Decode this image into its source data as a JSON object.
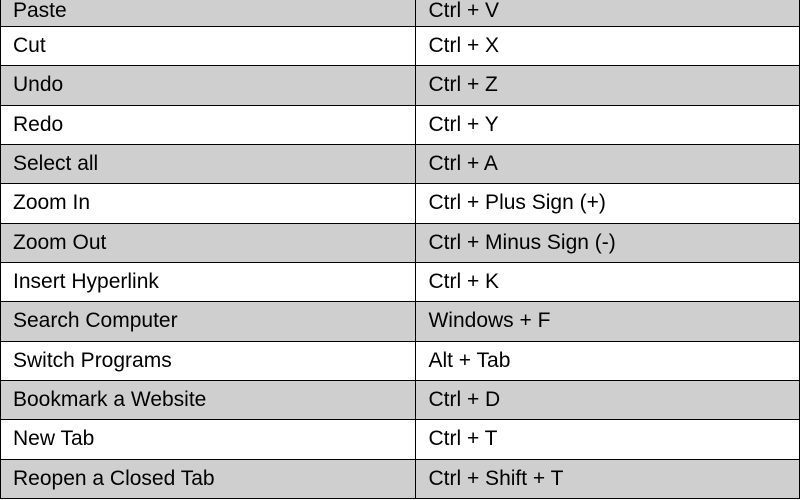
{
  "shortcuts": {
    "rows": [
      {
        "action": "Paste",
        "key": "Ctrl + V",
        "alt": true,
        "first": true
      },
      {
        "action": "Cut",
        "key": "Ctrl + X",
        "alt": false,
        "first": false
      },
      {
        "action": "Undo",
        "key": "Ctrl + Z",
        "alt": true,
        "first": false
      },
      {
        "action": "Redo",
        "key": "Ctrl + Y",
        "alt": false,
        "first": false
      },
      {
        "action": "Select all",
        "key": "Ctrl + A",
        "alt": true,
        "first": false
      },
      {
        "action": "Zoom In",
        "key": "Ctrl + Plus Sign (+)",
        "alt": false,
        "first": false
      },
      {
        "action": "Zoom Out",
        "key": "Ctrl + Minus Sign (-)",
        "alt": true,
        "first": false
      },
      {
        "action": "Insert Hyperlink",
        "key": "Ctrl + K",
        "alt": false,
        "first": false
      },
      {
        "action": "Search Computer",
        "key": "Windows + F",
        "alt": true,
        "first": false
      },
      {
        "action": "Switch Programs",
        "key": "Alt + Tab",
        "alt": false,
        "first": false
      },
      {
        "action": "Bookmark a Website",
        "key": "Ctrl + D",
        "alt": true,
        "first": false
      },
      {
        "action": "New Tab",
        "key": "Ctrl + T",
        "alt": false,
        "first": false
      },
      {
        "action": "Reopen a Closed Tab",
        "key": "Ctrl + Shift + T",
        "alt": true,
        "first": false
      }
    ]
  }
}
